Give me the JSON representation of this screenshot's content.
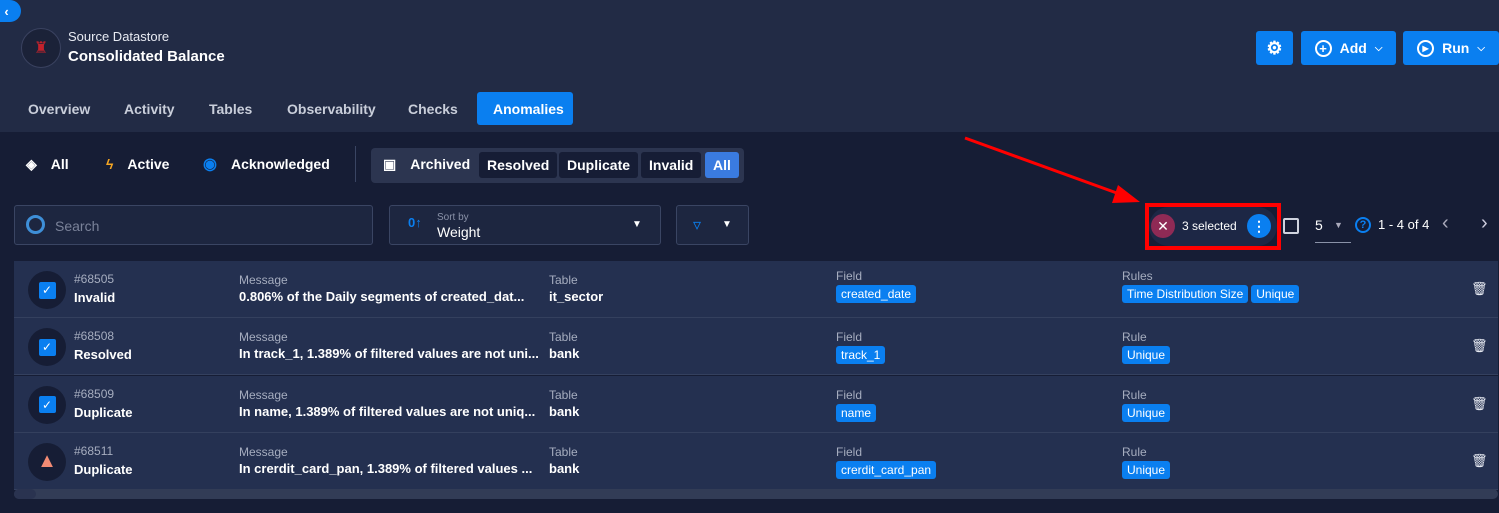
{
  "header": {
    "subtitle": "Source Datastore",
    "title": "Consolidated Balance",
    "add_label": "Add",
    "run_label": "Run"
  },
  "tabs": [
    {
      "label": "Overview"
    },
    {
      "label": "Activity"
    },
    {
      "label": "Tables"
    },
    {
      "label": "Observability"
    },
    {
      "label": "Checks"
    },
    {
      "label": "Anomalies",
      "active": true
    }
  ],
  "status_filters": [
    {
      "label": "All",
      "icon": "layers-icon"
    },
    {
      "label": "Active",
      "icon": "bolt-icon"
    },
    {
      "label": "Acknowledged",
      "icon": "eye-icon"
    }
  ],
  "archived": {
    "label": "Archived",
    "options": [
      "Resolved",
      "Duplicate",
      "Invalid",
      "All"
    ],
    "selected": "All"
  },
  "search": {
    "placeholder": "Search"
  },
  "sort": {
    "caption": "Sort by",
    "value": "Weight"
  },
  "selection": {
    "label": "3 selected"
  },
  "pagination": {
    "page_size": "5",
    "range": "1 - 4 of 4"
  },
  "colors": {
    "accent": "#0a7ff0",
    "header_bg": "#222b45",
    "page_bg": "#161d35",
    "row_bg": "#243050",
    "warning": "#f28b74"
  },
  "labels": {
    "message": "Message",
    "table": "Table",
    "field": "Field",
    "rules": "Rules",
    "rule": "Rule"
  },
  "rows": [
    {
      "id": "#68505",
      "type": "Invalid",
      "checked": true,
      "message": "0.806% of the Daily segments of created_dat...",
      "table": "it_sector",
      "field": "created_date",
      "rules_label": "Rules",
      "rules": [
        "Time Distribution Size",
        "Unique"
      ]
    },
    {
      "id": "#68508",
      "type": "Resolved",
      "checked": true,
      "message": "In track_1, 1.389% of filtered values are not uni...",
      "table": "bank",
      "field": "track_1",
      "rules_label": "Rule",
      "rules": [
        "Unique"
      ]
    },
    {
      "id": "#68509",
      "type": "Duplicate",
      "checked": true,
      "message": "In name, 1.389% of filtered values are not uniq...",
      "table": "bank",
      "field": "name",
      "rules_label": "Rule",
      "rules": [
        "Unique"
      ]
    },
    {
      "id": "#68511",
      "type": "Duplicate",
      "checked": false,
      "icon": "warning-icon",
      "message": "In crerdit_card_pan, 1.389% of filtered values ...",
      "table": "bank",
      "field": "crerdit_card_pan",
      "rules_label": "Rule",
      "rules": [
        "Unique"
      ]
    }
  ]
}
